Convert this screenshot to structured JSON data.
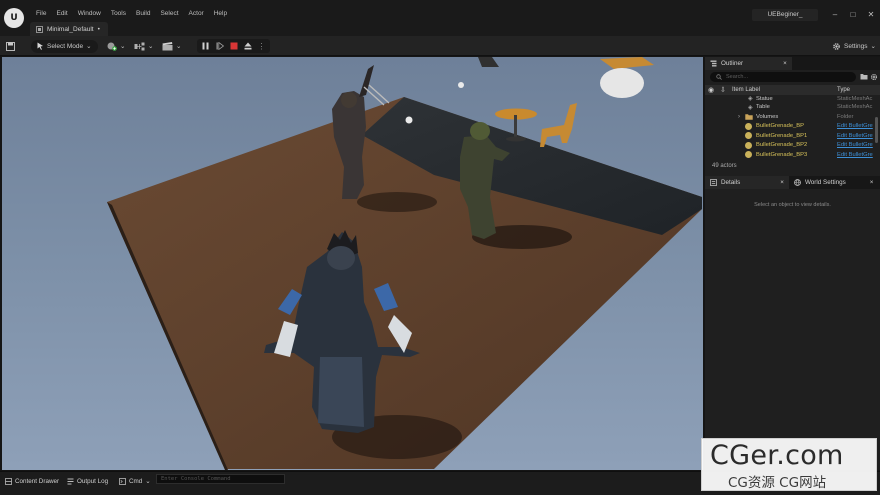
{
  "logo": {
    "text": "U",
    "icon": "unreal-logo-icon"
  },
  "menu": [
    "File",
    "Edit",
    "Window",
    "Tools",
    "Build",
    "Select",
    "Actor",
    "Help"
  ],
  "tab": {
    "label": "Minimal_Default",
    "modified_mark": "•",
    "icon": "level-icon"
  },
  "project": {
    "name": "UEBeginer_"
  },
  "window": {
    "minimize": "–",
    "maximize": "□",
    "close": "✕"
  },
  "toolbar": {
    "mode_label": "Select Mode",
    "settings_label": "Settings"
  },
  "outliner": {
    "tab_label": "Outliner",
    "close": "×",
    "search_placeholder": "Search...",
    "col_label": "Item Label",
    "col_type": "Type",
    "rows": [
      {
        "label": "Statue",
        "type": "StaticMeshAc",
        "kind": "mesh",
        "type_style": "plain"
      },
      {
        "label": "Table",
        "type": "StaticMeshAc",
        "kind": "mesh",
        "type_style": "plain"
      },
      {
        "label": "Volumes",
        "type": "Folder",
        "kind": "folder",
        "type_style": "plain"
      },
      {
        "label": "BulletGrenade_BP",
        "type": "Edit BulletGre",
        "kind": "bullet",
        "type_style": "link"
      },
      {
        "label": "BulletGrenade_BP1",
        "type": "Edit BulletGre",
        "kind": "bullet",
        "type_style": "link"
      },
      {
        "label": "BulletGrenade_BP2",
        "type": "Edit BulletGre",
        "kind": "bullet",
        "type_style": "link"
      },
      {
        "label": "BulletGrenade_BP3",
        "type": "Edit BulletGre",
        "kind": "bullet",
        "type_style": "link"
      }
    ],
    "footer": "49 actors"
  },
  "details": {
    "tab_label": "Details",
    "close": "×",
    "world_tab_label": "World Settings",
    "empty_message": "Select an object to view details."
  },
  "bottombar": {
    "content_drawer": "Content Drawer",
    "output_log": "Output Log",
    "cmd": "Cmd",
    "console_placeholder": "Enter Console Command"
  },
  "watermark": {
    "top": "CGer.com",
    "bottom": "CG资源 CG网站"
  },
  "colors": {
    "accent_play_stop": "#d93636",
    "link": "#3d8fd6",
    "bullet_label": "#d9c35a"
  }
}
